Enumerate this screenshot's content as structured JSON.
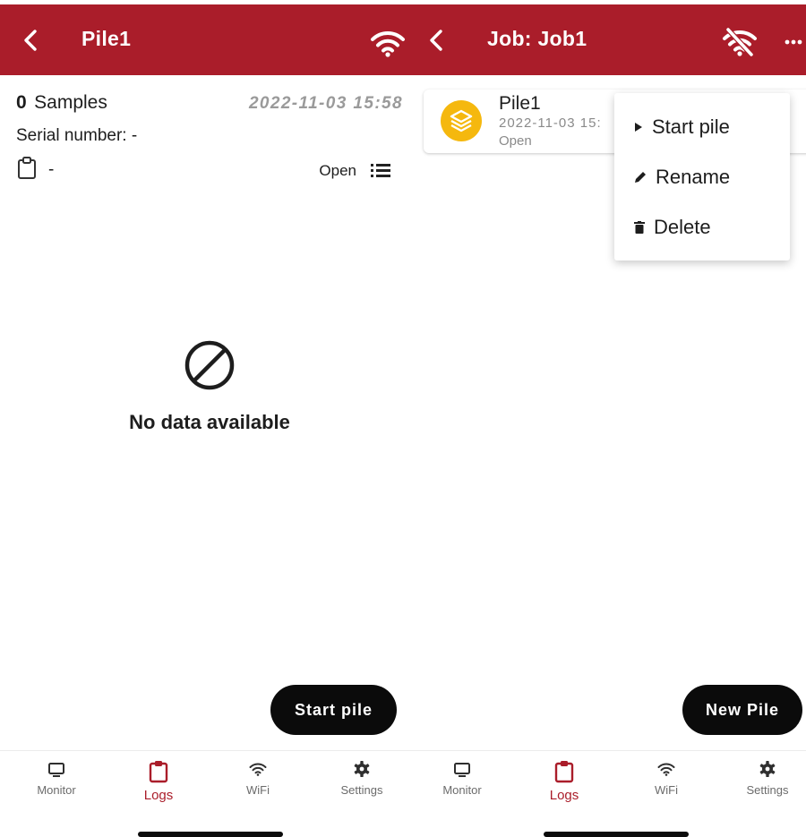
{
  "theme": {
    "brand": "#aa1d2a",
    "accent_yellow": "#f5b80e"
  },
  "left": {
    "header": {
      "title": "Pile1",
      "back_icon": "chevron-left-icon",
      "wifi_icon": "wifi-icon"
    },
    "info": {
      "sample_count": "0",
      "samples_label": "Samples",
      "timestamp": "2022-11-03 15:58",
      "serial": "Serial number: -",
      "clipboard_value": "-",
      "status": "Open"
    },
    "empty": {
      "message": "No data available",
      "icon": "no-data-icon"
    },
    "fab_label": "Start pile"
  },
  "right": {
    "header": {
      "title": "Job: Job1",
      "wifi_icon": "wifi-off-icon",
      "more_icon": "more-icon"
    },
    "pile_card": {
      "name": "Pile1",
      "timestamp": "2022-11-03 15:",
      "status": "Open",
      "icon": "layers-icon"
    },
    "menu": [
      {
        "label": "Start pile",
        "icon": "play-icon"
      },
      {
        "label": "Rename",
        "icon": "pencil-icon"
      },
      {
        "label": "Delete",
        "icon": "trash-icon"
      }
    ],
    "fab_label": "New Pile"
  },
  "tabs": [
    {
      "label": "Monitor",
      "icon": "monitor-icon",
      "active": false
    },
    {
      "label": "Logs",
      "icon": "clipboard-icon",
      "active": true
    },
    {
      "label": "WiFi",
      "icon": "wifi-icon",
      "active": false
    },
    {
      "label": "Settings",
      "icon": "gear-icon",
      "active": false
    }
  ]
}
